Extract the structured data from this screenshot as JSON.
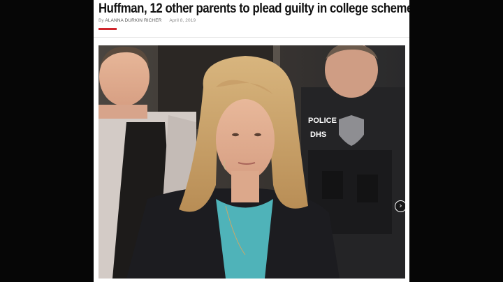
{
  "article": {
    "headline": "Huffman, 12 other parents to plead guilty in college scheme",
    "byline_prefix": "By",
    "author": "ALANNA DURKIN RICHER",
    "date": "April 8, 2019"
  },
  "photo": {
    "vest_text_line1": "POLICE",
    "vest_text_line2": "DHS"
  },
  "gallery": {
    "next_icon": "chevron-right-icon",
    "next_glyph": "›"
  },
  "colors": {
    "accent": "#d0262d",
    "frame_background": "#060606"
  }
}
